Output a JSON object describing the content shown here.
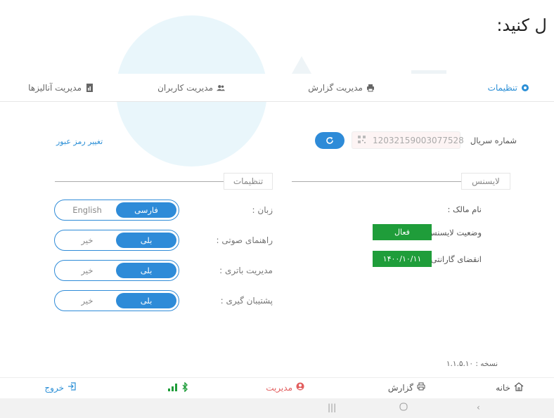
{
  "instruction_fragment": "ل کنید:",
  "tabs": [
    {
      "label": "تنظیمات",
      "icon": "gear-icon",
      "active": true
    },
    {
      "label": "مدیریت گزارش",
      "icon": "printer-icon",
      "active": false
    },
    {
      "label": "مدیریت کاربران",
      "icon": "users-icon",
      "active": false
    },
    {
      "label": "مدیریت آنالیزها",
      "icon": "document-icon",
      "active": false
    }
  ],
  "serial": {
    "label": "شماره سریال",
    "value": "12032159003077528",
    "qr_icon": "qr-code-icon",
    "refresh_icon": "refresh-icon"
  },
  "change_password_link": "تغییر رمز عبور",
  "license_section": {
    "title": "لایسنس",
    "owner_label": "نام مالک :",
    "status_label": "وضعیت لایسنس :",
    "status_value": "فعال",
    "warranty_label": "انقضای گارانتی :",
    "warranty_value": "۱۴۰۰/۱۰/۱۱"
  },
  "settings_section": {
    "title": "تنظیمات",
    "rows": [
      {
        "label": "زبان :",
        "on": "فارسی",
        "off": "English"
      },
      {
        "label": "راهنمای صوتی :",
        "on": "بلی",
        "off": "خیر"
      },
      {
        "label": "مدیریت باتری :",
        "on": "بلی",
        "off": "خیر"
      },
      {
        "label": "پشتیبان گیری :",
        "on": "بلی",
        "off": "خیر"
      }
    ]
  },
  "version": "نسخه : ۱.۱.۵.۱۰",
  "bottom_nav": {
    "home": "خانه",
    "report": "گزارش",
    "manage": "مدیریت",
    "logout": "خروج"
  },
  "colors": {
    "accent": "#2e8bd8",
    "success": "#1f9d3a",
    "active_nav": "#e25e5e"
  }
}
